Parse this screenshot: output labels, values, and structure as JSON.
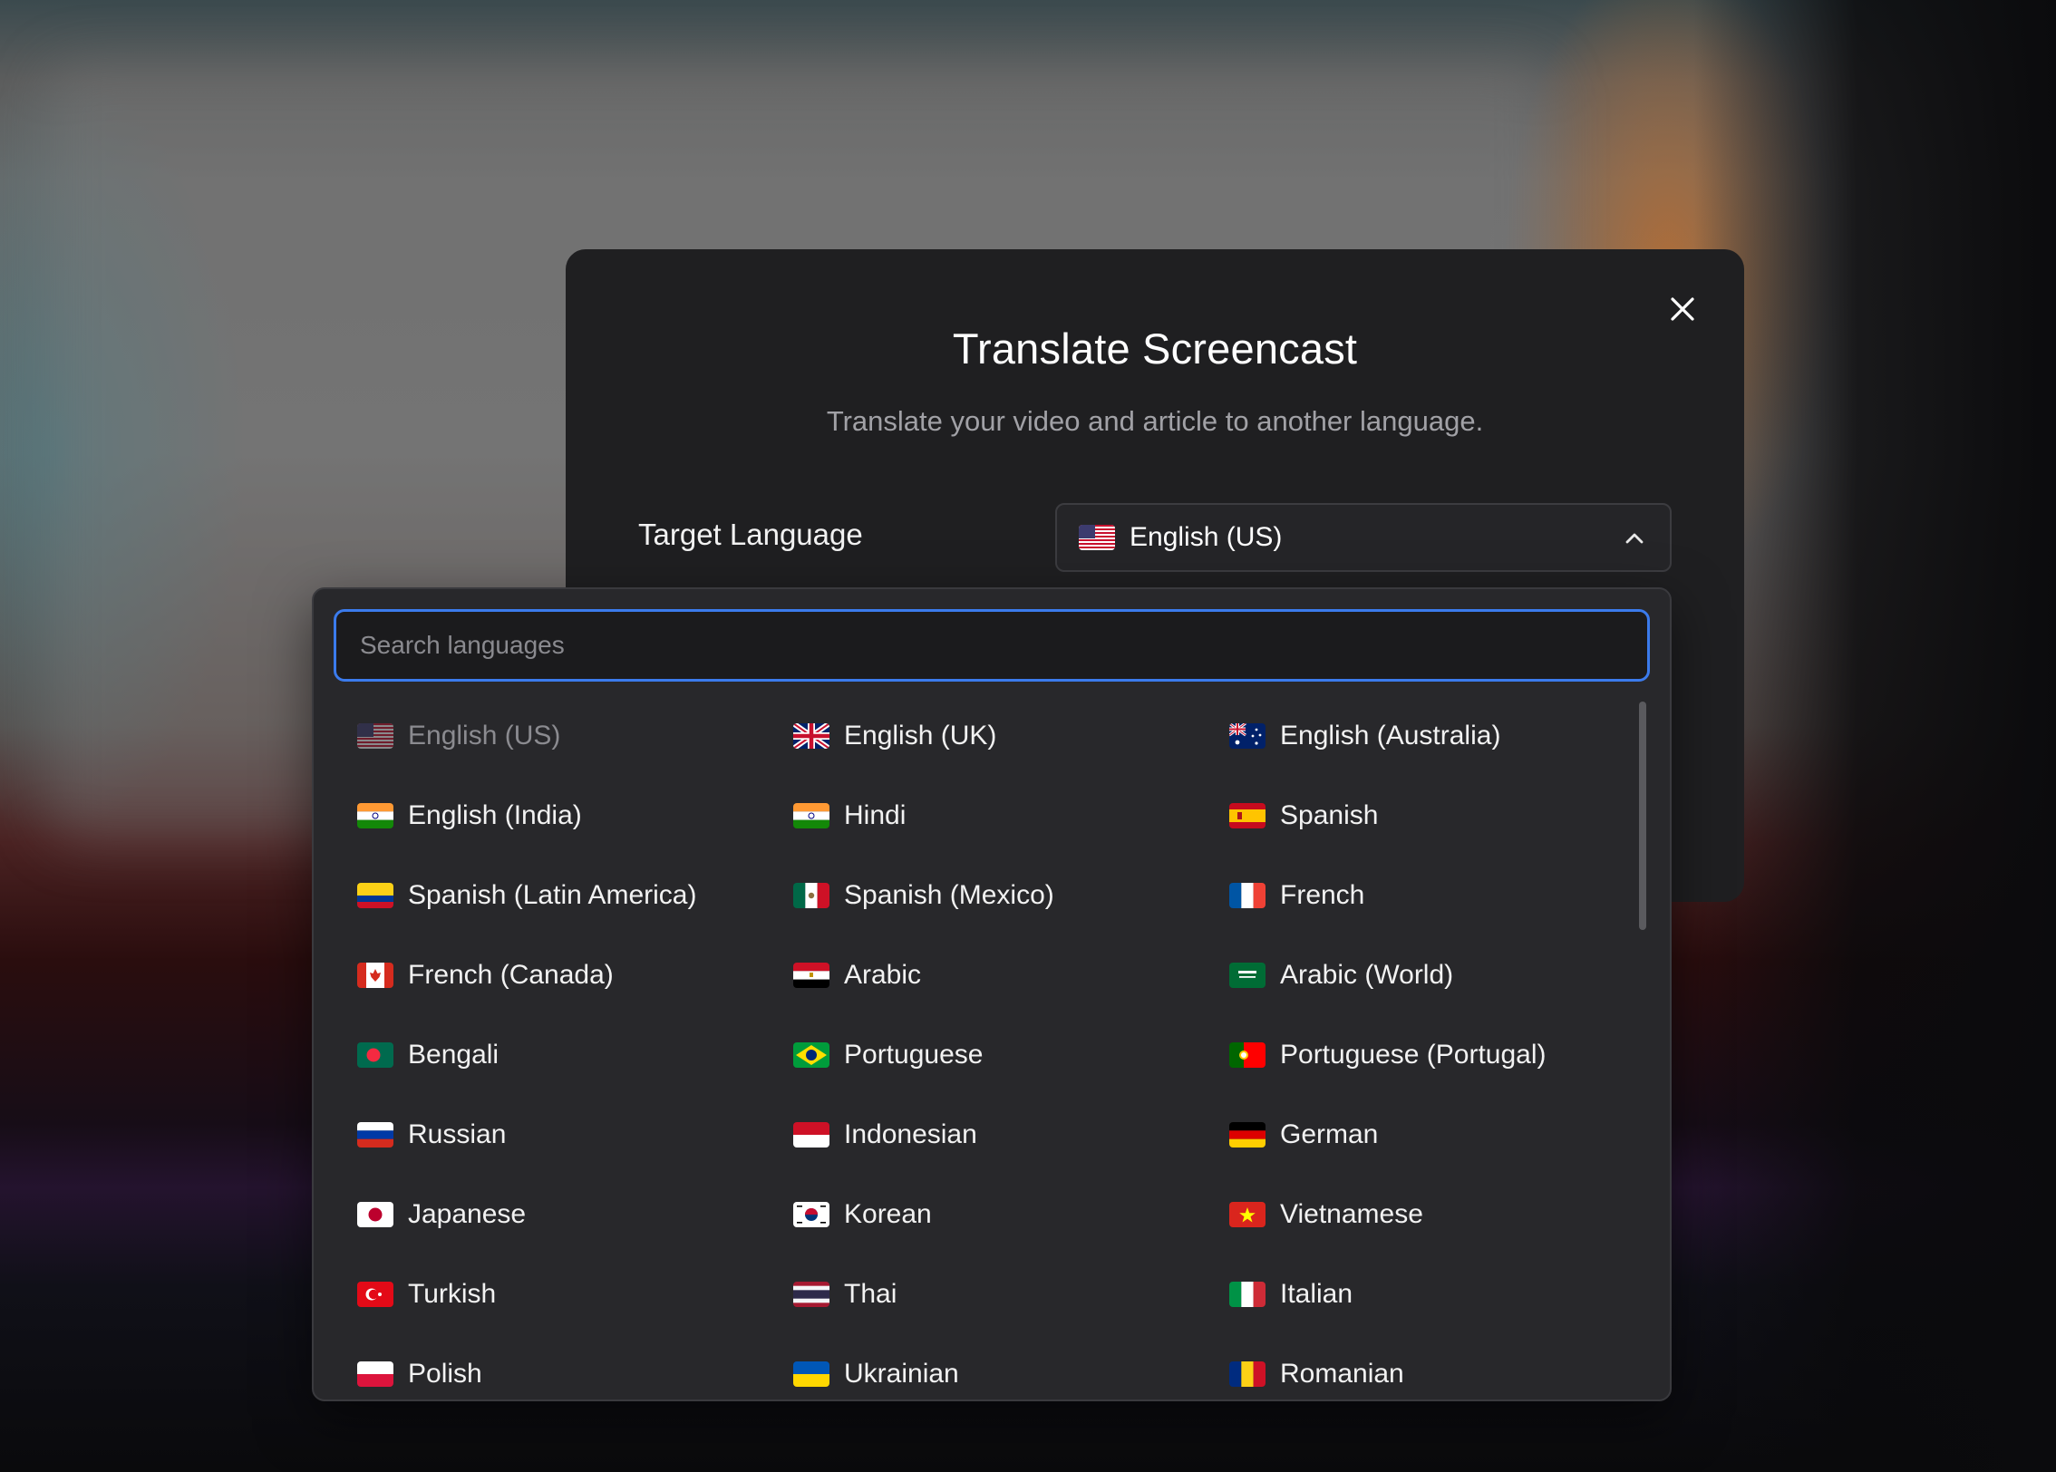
{
  "modal": {
    "title": "Translate Screencast",
    "subtitle": "Translate your video and article to another language.",
    "close_icon": "close-icon"
  },
  "target_language": {
    "label": "Target Language",
    "selected": "English (US)",
    "selected_flag": "us",
    "chevron_icon": "chevron-up-icon"
  },
  "search": {
    "placeholder": "Search languages",
    "value": ""
  },
  "languages": [
    {
      "name": "English (US)",
      "flag": "us",
      "selected": true
    },
    {
      "name": "English (UK)",
      "flag": "uk"
    },
    {
      "name": "English (Australia)",
      "flag": "au"
    },
    {
      "name": "English (India)",
      "flag": "in"
    },
    {
      "name": "Hindi",
      "flag": "in"
    },
    {
      "name": "Spanish",
      "flag": "es"
    },
    {
      "name": "Spanish (Latin America)",
      "flag": "co"
    },
    {
      "name": "Spanish (Mexico)",
      "flag": "mx"
    },
    {
      "name": "French",
      "flag": "fr"
    },
    {
      "name": "French (Canada)",
      "flag": "ca"
    },
    {
      "name": "Arabic",
      "flag": "eg"
    },
    {
      "name": "Arabic (World)",
      "flag": "sa"
    },
    {
      "name": "Bengali",
      "flag": "bd"
    },
    {
      "name": "Portuguese",
      "flag": "br"
    },
    {
      "name": "Portuguese (Portugal)",
      "flag": "pt"
    },
    {
      "name": "Russian",
      "flag": "ru"
    },
    {
      "name": "Indonesian",
      "flag": "id"
    },
    {
      "name": "German",
      "flag": "de"
    },
    {
      "name": "Japanese",
      "flag": "jp"
    },
    {
      "name": "Korean",
      "flag": "kr"
    },
    {
      "name": "Vietnamese",
      "flag": "vn"
    },
    {
      "name": "Turkish",
      "flag": "tr"
    },
    {
      "name": "Thai",
      "flag": "th"
    },
    {
      "name": "Italian",
      "flag": "it"
    },
    {
      "name": "Polish",
      "flag": "pl"
    },
    {
      "name": "Ukrainian",
      "flag": "ua"
    },
    {
      "name": "Romanian",
      "flag": "ro"
    }
  ],
  "colors": {
    "accent": "#3b7bec",
    "modal_bg": "#1f1f21",
    "dropdown_bg": "#28282b"
  }
}
